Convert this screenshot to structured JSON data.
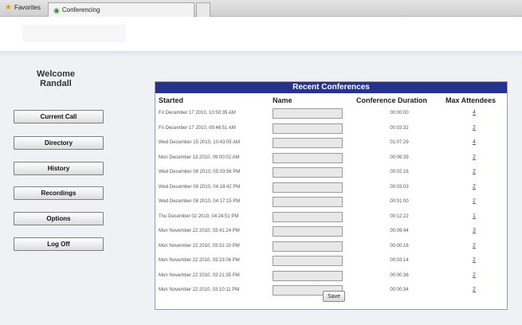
{
  "tabs": {
    "favorites_label": "Favorites",
    "conferencing_label": "Conferencing"
  },
  "sidebar": {
    "welcome_line1": "Welcome",
    "welcome_line2": "Randall",
    "nav": [
      {
        "label": "Current Call"
      },
      {
        "label": "Directory"
      },
      {
        "label": "History"
      },
      {
        "label": "Recordings"
      },
      {
        "label": "Options"
      },
      {
        "label": "Log Off"
      }
    ]
  },
  "panel": {
    "title": "Recent Conferences",
    "headers": {
      "started": "Started",
      "name": "Name",
      "duration": "Conference Duration",
      "attendees": "Max Attendees"
    },
    "rows": [
      {
        "started": "Fri December 17 2010, 10:50:35 AM",
        "name": "",
        "duration": "00:00:00",
        "attendees": "4"
      },
      {
        "started": "Fri December 17 2010, 09:46:51 AM",
        "name": "",
        "duration": "00:03:32",
        "attendees": "2"
      },
      {
        "started": "Wed December 15 2010, 10:43:05 AM",
        "name": "",
        "duration": "01:07:29",
        "attendees": "4"
      },
      {
        "started": "Mon December 13 2010, 09:00:02 AM",
        "name": "",
        "duration": "00:06:39",
        "attendees": "2"
      },
      {
        "started": "Wed December 08 2010, 05:03:56 PM",
        "name": "",
        "duration": "00:02:16",
        "attendees": "2"
      },
      {
        "started": "Wed December 08 2010, 04:18:42 PM",
        "name": "",
        "duration": "00:03:03",
        "attendees": "2"
      },
      {
        "started": "Wed December 08 2010, 04:17:15 PM",
        "name": "",
        "duration": "00:01:00",
        "attendees": "2"
      },
      {
        "started": "Thu December 02 2010, 04:24:51 PM",
        "name": "",
        "duration": "00:12:22",
        "attendees": "1"
      },
      {
        "started": "Mon November 22 2010, 03:41:24 PM",
        "name": "",
        "duration": "00:09:44",
        "attendees": "3"
      },
      {
        "started": "Mon November 22 2010, 03:31:10 PM",
        "name": "",
        "duration": "00:00:16",
        "attendees": "2"
      },
      {
        "started": "Mon November 22 2010, 03:23:06 PM",
        "name": "",
        "duration": "00:03:14",
        "attendees": "2"
      },
      {
        "started": "Mon November 22 2010, 03:21:35 PM",
        "name": "",
        "duration": "00:00:36",
        "attendees": "2"
      },
      {
        "started": "Mon November 22 2010, 03:10:11 PM",
        "name": "",
        "duration": "00:00:34",
        "attendees": "2"
      }
    ],
    "save_label": "Save"
  },
  "colors": {
    "title_bar": "#25338f",
    "link": "#3a4aa0"
  },
  "icons": [
    "star-icon",
    "globe-icon"
  ]
}
